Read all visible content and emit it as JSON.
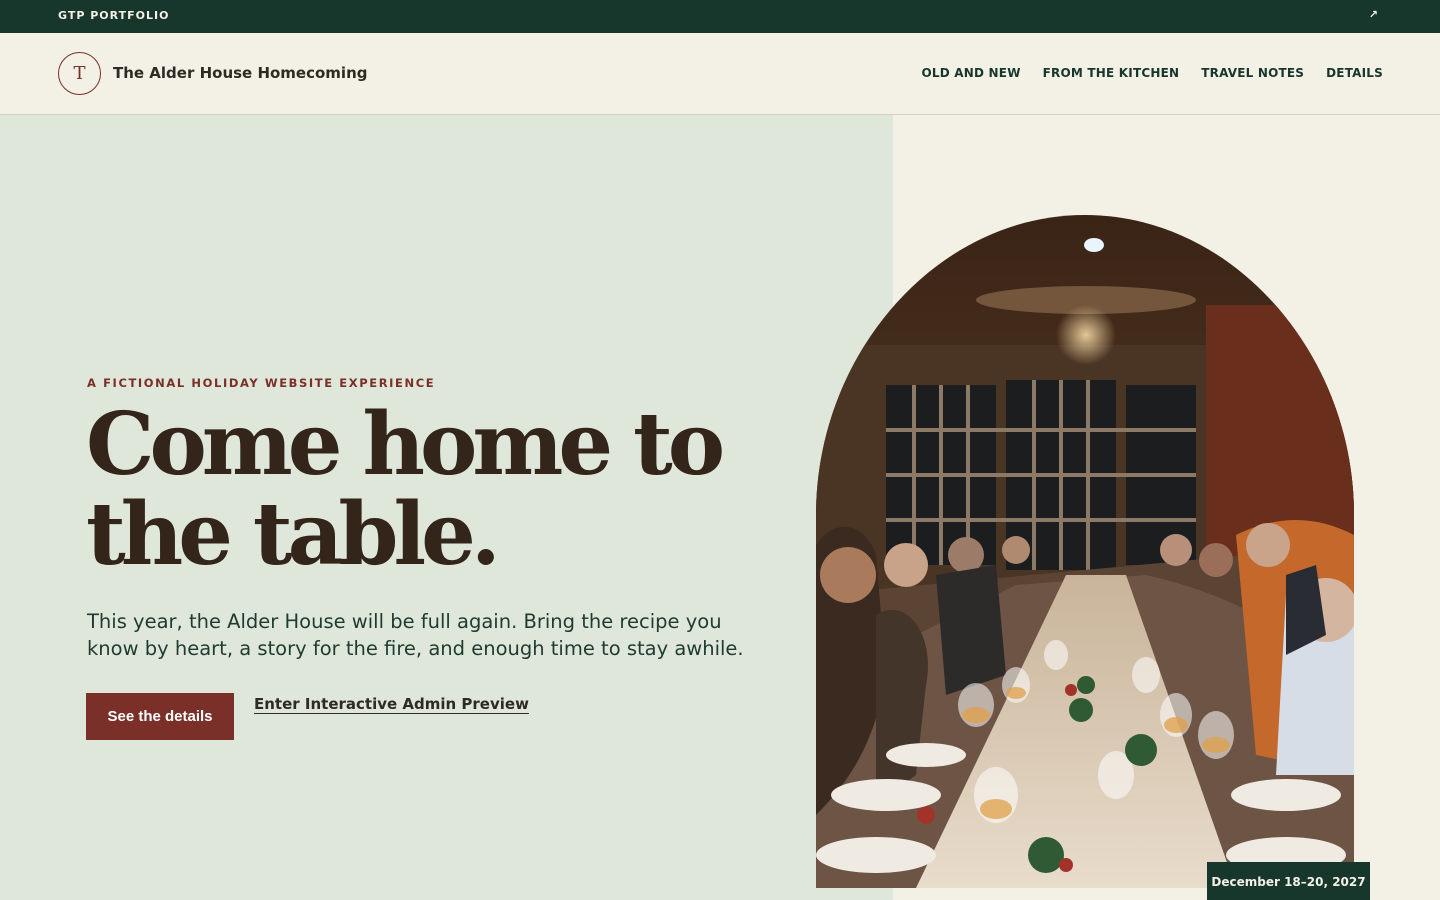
{
  "topbar": {
    "brand": "GTP PORTFOLIO",
    "external_icon": "↗"
  },
  "header": {
    "logo_letter": "T",
    "site_name": "The Alder House Homecoming",
    "nav": [
      {
        "label": "OLD AND NEW"
      },
      {
        "label": "FROM THE KITCHEN"
      },
      {
        "label": "TRAVEL NOTES"
      },
      {
        "label": "DETAILS"
      }
    ]
  },
  "hero": {
    "eyebrow": "A FICTIONAL HOLIDAY WEBSITE EXPERIENCE",
    "headline_line1": "Come home to",
    "headline_line2": "the table.",
    "subtext": "This year, the Alder House will be full again. Bring the recipe you know by heart, a story for the fire, and enough time to stay awhile.",
    "primary_button": "See the details",
    "secondary_link": "Enter Interactive Admin Preview",
    "date_badge": "December 18–20, 2027"
  },
  "colors": {
    "dark_green": "#17362c",
    "cream": "#f3f0e6",
    "sage": "#dfe6da",
    "brick": "#7a2f28",
    "ink": "#332519"
  }
}
